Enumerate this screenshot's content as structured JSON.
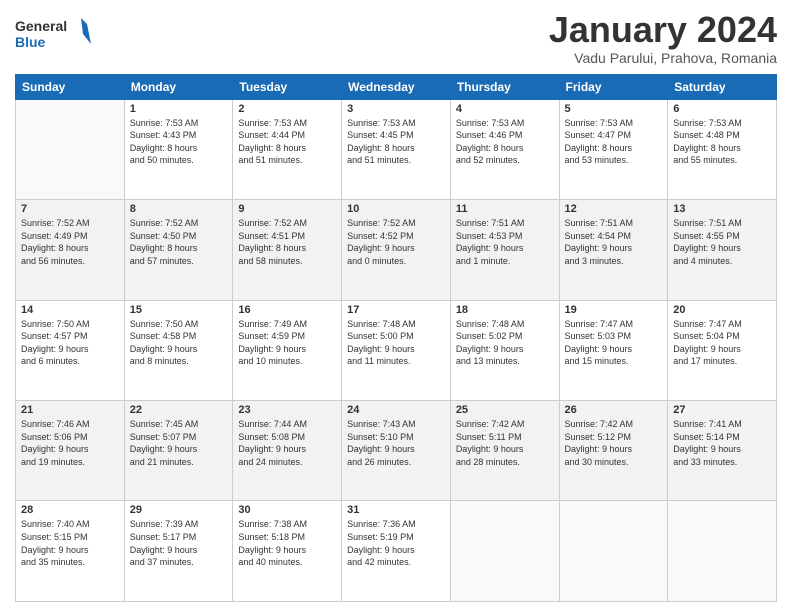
{
  "header": {
    "logo_line1": "General",
    "logo_line2": "Blue",
    "month_title": "January 2024",
    "location": "Vadu Parului, Prahova, Romania"
  },
  "days_of_week": [
    "Sunday",
    "Monday",
    "Tuesday",
    "Wednesday",
    "Thursday",
    "Friday",
    "Saturday"
  ],
  "weeks": [
    [
      {
        "day": "",
        "info": ""
      },
      {
        "day": "1",
        "info": "Sunrise: 7:53 AM\nSunset: 4:43 PM\nDaylight: 8 hours\nand 50 minutes."
      },
      {
        "day": "2",
        "info": "Sunrise: 7:53 AM\nSunset: 4:44 PM\nDaylight: 8 hours\nand 51 minutes."
      },
      {
        "day": "3",
        "info": "Sunrise: 7:53 AM\nSunset: 4:45 PM\nDaylight: 8 hours\nand 51 minutes."
      },
      {
        "day": "4",
        "info": "Sunrise: 7:53 AM\nSunset: 4:46 PM\nDaylight: 8 hours\nand 52 minutes."
      },
      {
        "day": "5",
        "info": "Sunrise: 7:53 AM\nSunset: 4:47 PM\nDaylight: 8 hours\nand 53 minutes."
      },
      {
        "day": "6",
        "info": "Sunrise: 7:53 AM\nSunset: 4:48 PM\nDaylight: 8 hours\nand 55 minutes."
      }
    ],
    [
      {
        "day": "7",
        "info": "Sunrise: 7:52 AM\nSunset: 4:49 PM\nDaylight: 8 hours\nand 56 minutes."
      },
      {
        "day": "8",
        "info": "Sunrise: 7:52 AM\nSunset: 4:50 PM\nDaylight: 8 hours\nand 57 minutes."
      },
      {
        "day": "9",
        "info": "Sunrise: 7:52 AM\nSunset: 4:51 PM\nDaylight: 8 hours\nand 58 minutes."
      },
      {
        "day": "10",
        "info": "Sunrise: 7:52 AM\nSunset: 4:52 PM\nDaylight: 9 hours\nand 0 minutes."
      },
      {
        "day": "11",
        "info": "Sunrise: 7:51 AM\nSunset: 4:53 PM\nDaylight: 9 hours\nand 1 minute."
      },
      {
        "day": "12",
        "info": "Sunrise: 7:51 AM\nSunset: 4:54 PM\nDaylight: 9 hours\nand 3 minutes."
      },
      {
        "day": "13",
        "info": "Sunrise: 7:51 AM\nSunset: 4:55 PM\nDaylight: 9 hours\nand 4 minutes."
      }
    ],
    [
      {
        "day": "14",
        "info": "Sunrise: 7:50 AM\nSunset: 4:57 PM\nDaylight: 9 hours\nand 6 minutes."
      },
      {
        "day": "15",
        "info": "Sunrise: 7:50 AM\nSunset: 4:58 PM\nDaylight: 9 hours\nand 8 minutes."
      },
      {
        "day": "16",
        "info": "Sunrise: 7:49 AM\nSunset: 4:59 PM\nDaylight: 9 hours\nand 10 minutes."
      },
      {
        "day": "17",
        "info": "Sunrise: 7:48 AM\nSunset: 5:00 PM\nDaylight: 9 hours\nand 11 minutes."
      },
      {
        "day": "18",
        "info": "Sunrise: 7:48 AM\nSunset: 5:02 PM\nDaylight: 9 hours\nand 13 minutes."
      },
      {
        "day": "19",
        "info": "Sunrise: 7:47 AM\nSunset: 5:03 PM\nDaylight: 9 hours\nand 15 minutes."
      },
      {
        "day": "20",
        "info": "Sunrise: 7:47 AM\nSunset: 5:04 PM\nDaylight: 9 hours\nand 17 minutes."
      }
    ],
    [
      {
        "day": "21",
        "info": "Sunrise: 7:46 AM\nSunset: 5:06 PM\nDaylight: 9 hours\nand 19 minutes."
      },
      {
        "day": "22",
        "info": "Sunrise: 7:45 AM\nSunset: 5:07 PM\nDaylight: 9 hours\nand 21 minutes."
      },
      {
        "day": "23",
        "info": "Sunrise: 7:44 AM\nSunset: 5:08 PM\nDaylight: 9 hours\nand 24 minutes."
      },
      {
        "day": "24",
        "info": "Sunrise: 7:43 AM\nSunset: 5:10 PM\nDaylight: 9 hours\nand 26 minutes."
      },
      {
        "day": "25",
        "info": "Sunrise: 7:42 AM\nSunset: 5:11 PM\nDaylight: 9 hours\nand 28 minutes."
      },
      {
        "day": "26",
        "info": "Sunrise: 7:42 AM\nSunset: 5:12 PM\nDaylight: 9 hours\nand 30 minutes."
      },
      {
        "day": "27",
        "info": "Sunrise: 7:41 AM\nSunset: 5:14 PM\nDaylight: 9 hours\nand 33 minutes."
      }
    ],
    [
      {
        "day": "28",
        "info": "Sunrise: 7:40 AM\nSunset: 5:15 PM\nDaylight: 9 hours\nand 35 minutes."
      },
      {
        "day": "29",
        "info": "Sunrise: 7:39 AM\nSunset: 5:17 PM\nDaylight: 9 hours\nand 37 minutes."
      },
      {
        "day": "30",
        "info": "Sunrise: 7:38 AM\nSunset: 5:18 PM\nDaylight: 9 hours\nand 40 minutes."
      },
      {
        "day": "31",
        "info": "Sunrise: 7:36 AM\nSunset: 5:19 PM\nDaylight: 9 hours\nand 42 minutes."
      },
      {
        "day": "",
        "info": ""
      },
      {
        "day": "",
        "info": ""
      },
      {
        "day": "",
        "info": ""
      }
    ]
  ]
}
